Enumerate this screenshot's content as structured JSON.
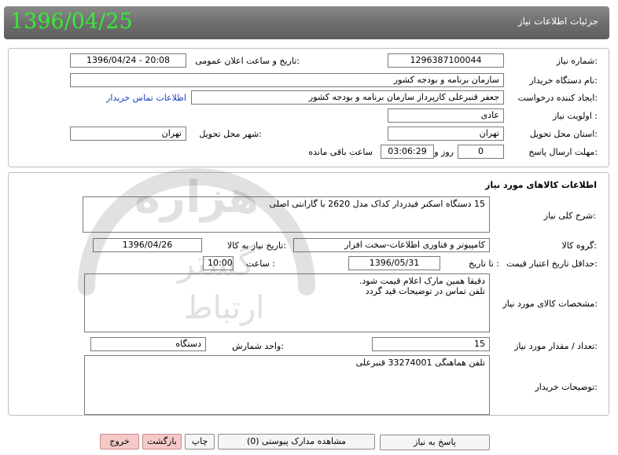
{
  "header": {
    "title": "جزئيات اطلاعات نیاز",
    "date": "1396/04/25"
  },
  "details": {
    "need_number_label": "شماره نیاز:",
    "need_number": "1296387100044",
    "announce_label": "تاریخ و ساعت اعلان عمومی:",
    "announce_value": "1396/04/24 - 20:08",
    "buyer_org_label": "نام دستگاه خریدار:",
    "buyer_org": "سازمان برنامه و بودجه کشور",
    "creator_label": "ایجاد کننده درخواست:",
    "creator": "جعفر قنبرعلی کارپرداز سازمان برنامه و بودجه کشور",
    "contact_link": "اطلاعات تماس خریدار",
    "priority_label": "اولویت نیاز :",
    "priority": "عادی",
    "province_label": "استان محل تحویل:",
    "province": "تهران",
    "city_label": "شهر محل تحویل:",
    "city": "تهران",
    "deadline_label": "مهلت ارسال پاسخ:",
    "deadline_days": "0",
    "days_text": "روز و",
    "deadline_time": "03:06:29",
    "remaining_text": "ساعت باقی مانده"
  },
  "goods": {
    "section_title": "اطلاعات کالاهای مورد نیاز",
    "summary_label": "شرح کلی نیاز:",
    "summary": "15 دستگاه اسکنر فیدردار کداک مدل 2620 با گارانتی اصلی",
    "group_label": "گروه کالا:",
    "group": "کامپیوتر و فناوری اطلاعات-سخت افزار",
    "need_date_label": "تاریخ نیاز به کالا:",
    "need_date": "1396/04/26",
    "validity_label": "حداقل تاریخ اعتبار قیمت:",
    "until_label": "تا تاریخ :",
    "validity_date": "1396/05/31",
    "time_label": "ساعت :",
    "validity_time": "10:00",
    "specs_label": "مشخصات کالای مورد نیاز:",
    "specs_line1": "دقیقا همین مارک اعلام قیمت شود.",
    "specs_line2": "تلفن تماس در توضیحات قید گردد",
    "qty_label": "تعداد / مقدار مورد نیاز:",
    "qty": "15",
    "unit_label": "واحد شمارش:",
    "unit": "دستگاه",
    "buyer_notes_label": "توضیحات خریدار:",
    "buyer_notes": "تلفن هماهنگی 33274001 قنبرعلی"
  },
  "buttons": {
    "reply": "پاسخ به نیاز",
    "attachments": "مشاهده مدارک پیوستی (0)",
    "print": "چاپ",
    "back": "بازگشت",
    "exit": "خروج"
  },
  "watermark": {
    "brand": "هزاره",
    "line1": "گستر",
    "line2": "ارتباط"
  },
  "colors": {
    "header_bg": "#6f6f6f",
    "date_green": "#33ee33",
    "link_blue": "#1a3fc0",
    "exit_red": "#f6c9c9"
  }
}
